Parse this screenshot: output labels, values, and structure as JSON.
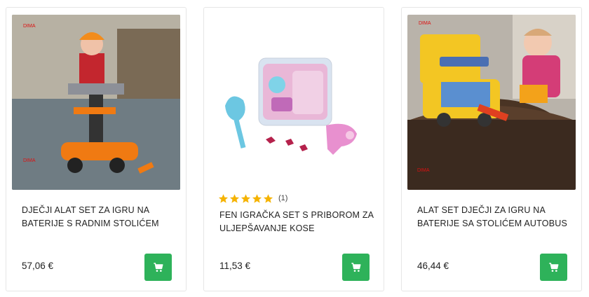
{
  "products": [
    {
      "title": "DJEČJI ALAT SET ZA IGRU NA BATERIJE S RADNIM STOLIĆEM",
      "price": "57,06 €",
      "brand_mark": "DIMA"
    },
    {
      "title": "FEN IGRAČKA SET S PRIBOROM ZA ULJEPŠAVANJE KOSE",
      "price": "11,53 €",
      "rating_stars": 5,
      "rating_count": "(1)"
    },
    {
      "title": "ALAT SET DJEČJI ZA IGRU NA BATERIJE SA STOLIĆEM AUTOBUS",
      "price": "46,44 €",
      "brand_mark": "DIMA"
    }
  ],
  "colors": {
    "cart_button": "#2eb25a",
    "star": "#f5b301",
    "text": "#222222",
    "card_border": "#e6e6e6"
  },
  "icons": {
    "cart": "shopping-cart-icon",
    "star": "star-icon"
  }
}
